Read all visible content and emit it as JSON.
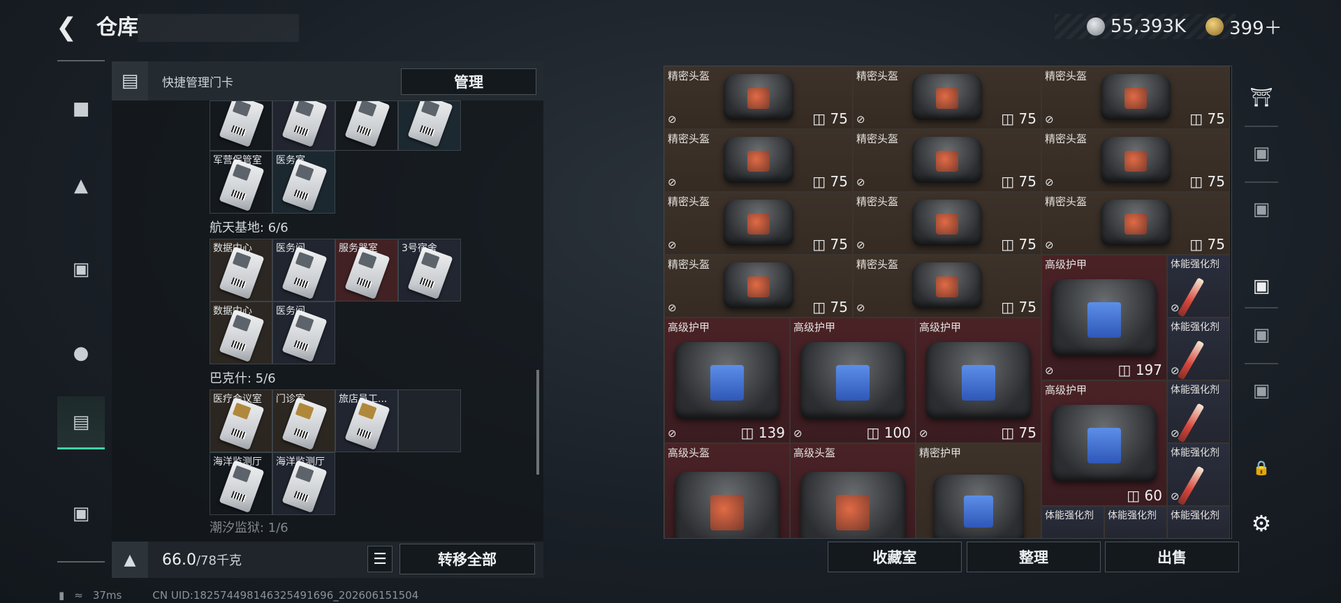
{
  "header": {
    "title": "仓库",
    "silver": "55,393K",
    "gold": "399＋"
  },
  "quick_manage": {
    "label": "快捷管理门卡",
    "button": "管理"
  },
  "groups": [
    {
      "label": "航天基地: 6/6"
    },
    {
      "label": "巴克什: 5/6"
    },
    {
      "label": "潮汐监狱: 1/6"
    }
  ],
  "cards_top": [
    "军营保管室",
    "医务室"
  ],
  "cards_bakesh": [
    "数据中心",
    "医务间",
    "服务器室",
    "3号宿舍",
    "数据中心",
    "医务间"
  ],
  "cards_tide": [
    "医疗会议室",
    "门诊室",
    "旅店员工...",
    "海洋监测厅",
    "海洋监测厅"
  ],
  "weight": {
    "value": "66.0",
    "unit": "/78千克"
  },
  "transfer_all": "转移全部",
  "status": {
    "ping": "37ms",
    "uid": "CN UID:1825744981463254916​96_202606151504"
  },
  "items": {
    "precise_helmet": "精密头盔",
    "advanced_armor": "高级护甲",
    "advanced_helmet": "高级头盔",
    "precise_armor": "精密护甲",
    "stim": "体能强化剂",
    "d75": "75",
    "d197": "197",
    "d139": "139",
    "d100": "100",
    "d60": "60"
  },
  "bottom_buttons": {
    "collection": "收藏室",
    "sort": "整理",
    "sell": "出售"
  }
}
